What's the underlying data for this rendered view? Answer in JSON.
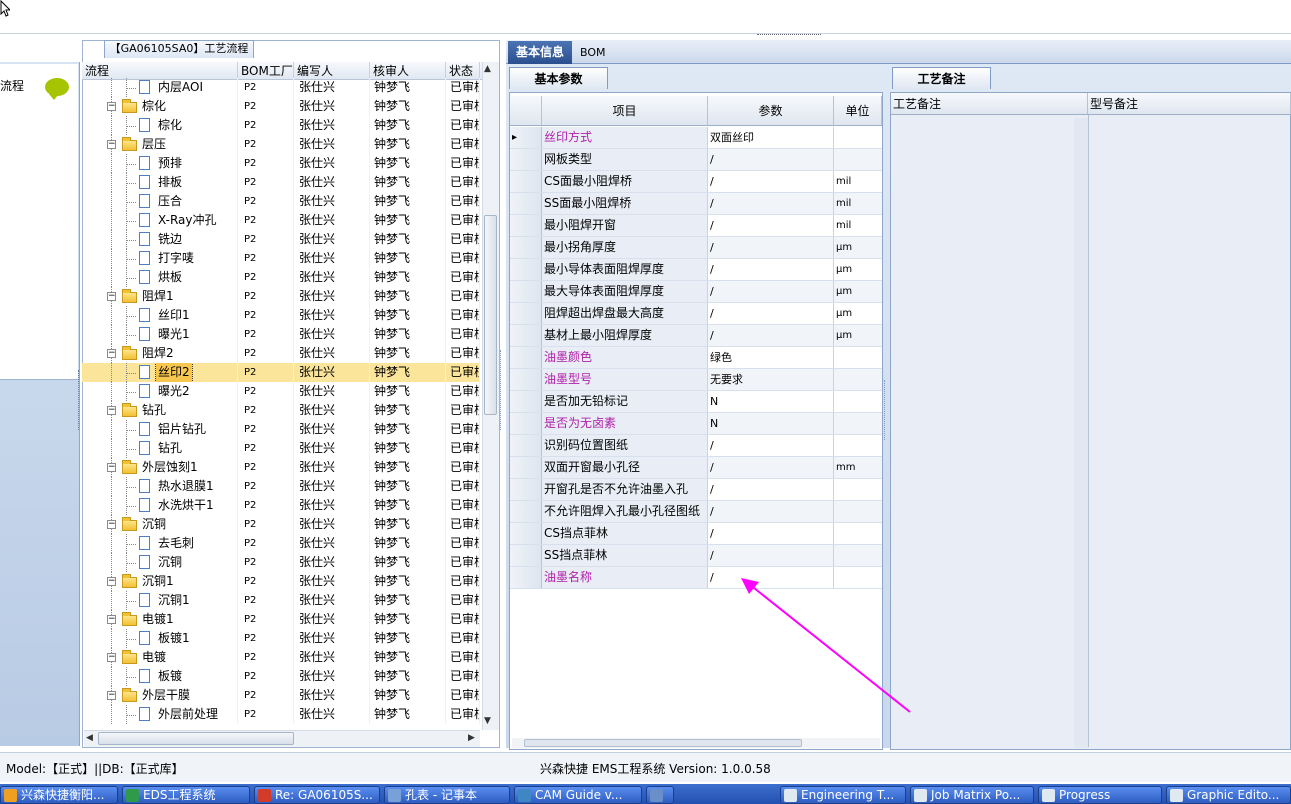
{
  "tree_panel": {
    "title": "【GA06105SA0】工艺流程",
    "columns": [
      "流程",
      "BOM工厂",
      "编写人",
      "核审人",
      "状态"
    ],
    "rows": [
      {
        "label": "内层AOI",
        "type": "doc",
        "level": 2,
        "bom": "P2",
        "author": "张仕兴",
        "reviewer": "钟梦飞",
        "status": "已审核"
      },
      {
        "label": "棕化",
        "type": "folder",
        "level": 1,
        "bom": "P2",
        "author": "张仕兴",
        "reviewer": "钟梦飞",
        "status": "已审核"
      },
      {
        "label": "棕化",
        "type": "doc",
        "level": 2,
        "bom": "P2",
        "author": "张仕兴",
        "reviewer": "钟梦飞",
        "status": "已审核"
      },
      {
        "label": "层压",
        "type": "folder",
        "level": 1,
        "bom": "P2",
        "author": "张仕兴",
        "reviewer": "钟梦飞",
        "status": "已审核"
      },
      {
        "label": "预排",
        "type": "doc",
        "level": 2,
        "bom": "P2",
        "author": "张仕兴",
        "reviewer": "钟梦飞",
        "status": "已审核"
      },
      {
        "label": "排板",
        "type": "doc",
        "level": 2,
        "bom": "P2",
        "author": "张仕兴",
        "reviewer": "钟梦飞",
        "status": "已审核"
      },
      {
        "label": "压合",
        "type": "doc",
        "level": 2,
        "bom": "P2",
        "author": "张仕兴",
        "reviewer": "钟梦飞",
        "status": "已审核"
      },
      {
        "label": "X-Ray冲孔",
        "type": "doc",
        "level": 2,
        "bom": "P2",
        "author": "张仕兴",
        "reviewer": "钟梦飞",
        "status": "已审核"
      },
      {
        "label": "铣边",
        "type": "doc",
        "level": 2,
        "bom": "P2",
        "author": "张仕兴",
        "reviewer": "钟梦飞",
        "status": "已审核"
      },
      {
        "label": "打字唛",
        "type": "doc",
        "level": 2,
        "bom": "P2",
        "author": "张仕兴",
        "reviewer": "钟梦飞",
        "status": "已审核"
      },
      {
        "label": "烘板",
        "type": "doc",
        "level": 2,
        "bom": "P2",
        "author": "张仕兴",
        "reviewer": "钟梦飞",
        "status": "已审核"
      },
      {
        "label": "阻焊1",
        "type": "folder",
        "level": 1,
        "bom": "P2",
        "author": "张仕兴",
        "reviewer": "钟梦飞",
        "status": "已审核"
      },
      {
        "label": "丝印1",
        "type": "doc",
        "level": 2,
        "bom": "P2",
        "author": "张仕兴",
        "reviewer": "钟梦飞",
        "status": "已审核"
      },
      {
        "label": "曝光1",
        "type": "doc",
        "level": 2,
        "bom": "P2",
        "author": "张仕兴",
        "reviewer": "钟梦飞",
        "status": "已审核"
      },
      {
        "label": "阻焊2",
        "type": "folder",
        "level": 1,
        "bom": "P2",
        "author": "张仕兴",
        "reviewer": "钟梦飞",
        "status": "已审核"
      },
      {
        "label": "丝印2",
        "type": "doc",
        "level": 2,
        "bom": "P2",
        "author": "张仕兴",
        "reviewer": "钟梦飞",
        "status": "已审核",
        "selected": true
      },
      {
        "label": "曝光2",
        "type": "doc",
        "level": 2,
        "bom": "P2",
        "author": "张仕兴",
        "reviewer": "钟梦飞",
        "status": "已审核"
      },
      {
        "label": "钻孔",
        "type": "folder",
        "level": 1,
        "bom": "P2",
        "author": "张仕兴",
        "reviewer": "钟梦飞",
        "status": "已审核"
      },
      {
        "label": "铝片钻孔",
        "type": "doc",
        "level": 2,
        "bom": "P2",
        "author": "张仕兴",
        "reviewer": "钟梦飞",
        "status": "已审核"
      },
      {
        "label": "钻孔",
        "type": "doc",
        "level": 2,
        "bom": "P2",
        "author": "张仕兴",
        "reviewer": "钟梦飞",
        "status": "已审核"
      },
      {
        "label": "外层蚀刻1",
        "type": "folder",
        "level": 1,
        "bom": "P2",
        "author": "张仕兴",
        "reviewer": "钟梦飞",
        "status": "已审核"
      },
      {
        "label": "热水退膜1",
        "type": "doc",
        "level": 2,
        "bom": "P2",
        "author": "张仕兴",
        "reviewer": "钟梦飞",
        "status": "已审核"
      },
      {
        "label": "水洗烘干1",
        "type": "doc",
        "level": 2,
        "bom": "P2",
        "author": "张仕兴",
        "reviewer": "钟梦飞",
        "status": "已审核"
      },
      {
        "label": "沉铜",
        "type": "folder",
        "level": 1,
        "bom": "P2",
        "author": "张仕兴",
        "reviewer": "钟梦飞",
        "status": "已审核"
      },
      {
        "label": "去毛刺",
        "type": "doc",
        "level": 2,
        "bom": "P2",
        "author": "张仕兴",
        "reviewer": "钟梦飞",
        "status": "已审核"
      },
      {
        "label": "沉铜",
        "type": "doc",
        "level": 2,
        "bom": "P2",
        "author": "张仕兴",
        "reviewer": "钟梦飞",
        "status": "已审核"
      },
      {
        "label": "沉铜1",
        "type": "folder",
        "level": 1,
        "bom": "P2",
        "author": "张仕兴",
        "reviewer": "钟梦飞",
        "status": "已审核"
      },
      {
        "label": "沉铜1",
        "type": "doc",
        "level": 2,
        "bom": "P2",
        "author": "张仕兴",
        "reviewer": "钟梦飞",
        "status": "已审核"
      },
      {
        "label": "电镀1",
        "type": "folder",
        "level": 1,
        "bom": "P2",
        "author": "张仕兴",
        "reviewer": "钟梦飞",
        "status": "已审核"
      },
      {
        "label": "板镀1",
        "type": "doc",
        "level": 2,
        "bom": "P2",
        "author": "张仕兴",
        "reviewer": "钟梦飞",
        "status": "已审核"
      },
      {
        "label": "电镀",
        "type": "folder",
        "level": 1,
        "bom": "P2",
        "author": "张仕兴",
        "reviewer": "钟梦飞",
        "status": "已审核"
      },
      {
        "label": "板镀",
        "type": "doc",
        "level": 2,
        "bom": "P2",
        "author": "张仕兴",
        "reviewer": "钟梦飞",
        "status": "已审核"
      },
      {
        "label": "外层干膜",
        "type": "folder",
        "level": 1,
        "bom": "P2",
        "author": "张仕兴",
        "reviewer": "钟梦飞",
        "status": "已审核"
      },
      {
        "label": "外层前处理",
        "type": "doc",
        "level": 2,
        "bom": "P2",
        "author": "张仕兴",
        "reviewer": "钟梦飞",
        "status": "已审核"
      }
    ]
  },
  "nav": {
    "label": "流程",
    "icon": "chat-bubble-icon"
  },
  "right_tabs": [
    {
      "label": "基本信息",
      "active": true
    },
    {
      "label": "BOM",
      "active": false
    }
  ],
  "params_panel": {
    "tab": "基本参数",
    "columns": [
      "项目",
      "参数",
      "单位"
    ],
    "rows": [
      {
        "item": "丝印方式",
        "value": "双面丝印",
        "unit": "",
        "highlight": true,
        "current": true
      },
      {
        "item": "网板类型",
        "value": "/",
        "unit": ""
      },
      {
        "item": "CS面最小阻焊桥",
        "value": "/",
        "unit": "mil"
      },
      {
        "item": "SS面最小阻焊桥",
        "value": "/",
        "unit": "mil"
      },
      {
        "item": "最小阻焊开窗",
        "value": "/",
        "unit": "mil"
      },
      {
        "item": "最小拐角厚度",
        "value": "/",
        "unit": "μm"
      },
      {
        "item": "最小导体表面阻焊厚度",
        "value": "/",
        "unit": "μm"
      },
      {
        "item": "最大导体表面阻焊厚度",
        "value": "/",
        "unit": "μm"
      },
      {
        "item": "阻焊超出焊盘最大高度",
        "value": "/",
        "unit": "μm"
      },
      {
        "item": "基材上最小阻焊厚度",
        "value": "/",
        "unit": "μm"
      },
      {
        "item": "油墨颜色",
        "value": "绿色",
        "unit": "",
        "highlight": true
      },
      {
        "item": "油墨型号",
        "value": "无要求",
        "unit": "",
        "highlight": true
      },
      {
        "item": "是否加无铅标记",
        "value": "N",
        "unit": ""
      },
      {
        "item": "是否为无卤素",
        "value": "N",
        "unit": "",
        "highlight": true
      },
      {
        "item": "识别码位置图纸",
        "value": "/",
        "unit": ""
      },
      {
        "item": "双面开窗最小孔径",
        "value": "/",
        "unit": "mm"
      },
      {
        "item": "开窗孔是否不允许油墨入孔",
        "value": "/",
        "unit": ""
      },
      {
        "item": "不允许阻焊入孔最小孔径图纸",
        "value": "/",
        "unit": ""
      },
      {
        "item": "CS挡点菲林",
        "value": "/",
        "unit": ""
      },
      {
        "item": "SS挡点菲林",
        "value": "/",
        "unit": ""
      },
      {
        "item": "油墨名称",
        "value": "/",
        "unit": "",
        "highlight": true
      }
    ]
  },
  "remarks_panel": {
    "tab": "工艺备注",
    "columns": [
      "工艺备注",
      "型号备注"
    ]
  },
  "status": {
    "left": "Model:【正式】||DB:【正式库】",
    "right": "兴森快捷 EMS工程系统 Version: 1.0.0.58"
  },
  "taskbar": [
    {
      "label": "兴森快捷衡阳...",
      "icon": "app-icon"
    },
    {
      "label": "EDS工程系统",
      "icon": "eds-icon"
    },
    {
      "label": "Re: GA06105S...",
      "icon": "mail-icon"
    },
    {
      "label": "孔表 - 记事本",
      "icon": "notepad-icon"
    },
    {
      "label": "CAM Guide v...",
      "icon": "cam-icon"
    },
    {
      "label": "",
      "icon": "window-icon"
    },
    {
      "label": "Engineering T...",
      "icon": "x-icon"
    },
    {
      "label": "Job Matrix Po...",
      "icon": "x-icon"
    },
    {
      "label": "Progress",
      "icon": "x-icon"
    },
    {
      "label": "Graphic Edito...",
      "icon": "x-icon"
    }
  ],
  "colors": {
    "highlight_text": "#b01ea8",
    "annotation_arrow": "#ff00ff",
    "selected_row": "#fbe59a",
    "tab_active": "#2b4f8d"
  }
}
